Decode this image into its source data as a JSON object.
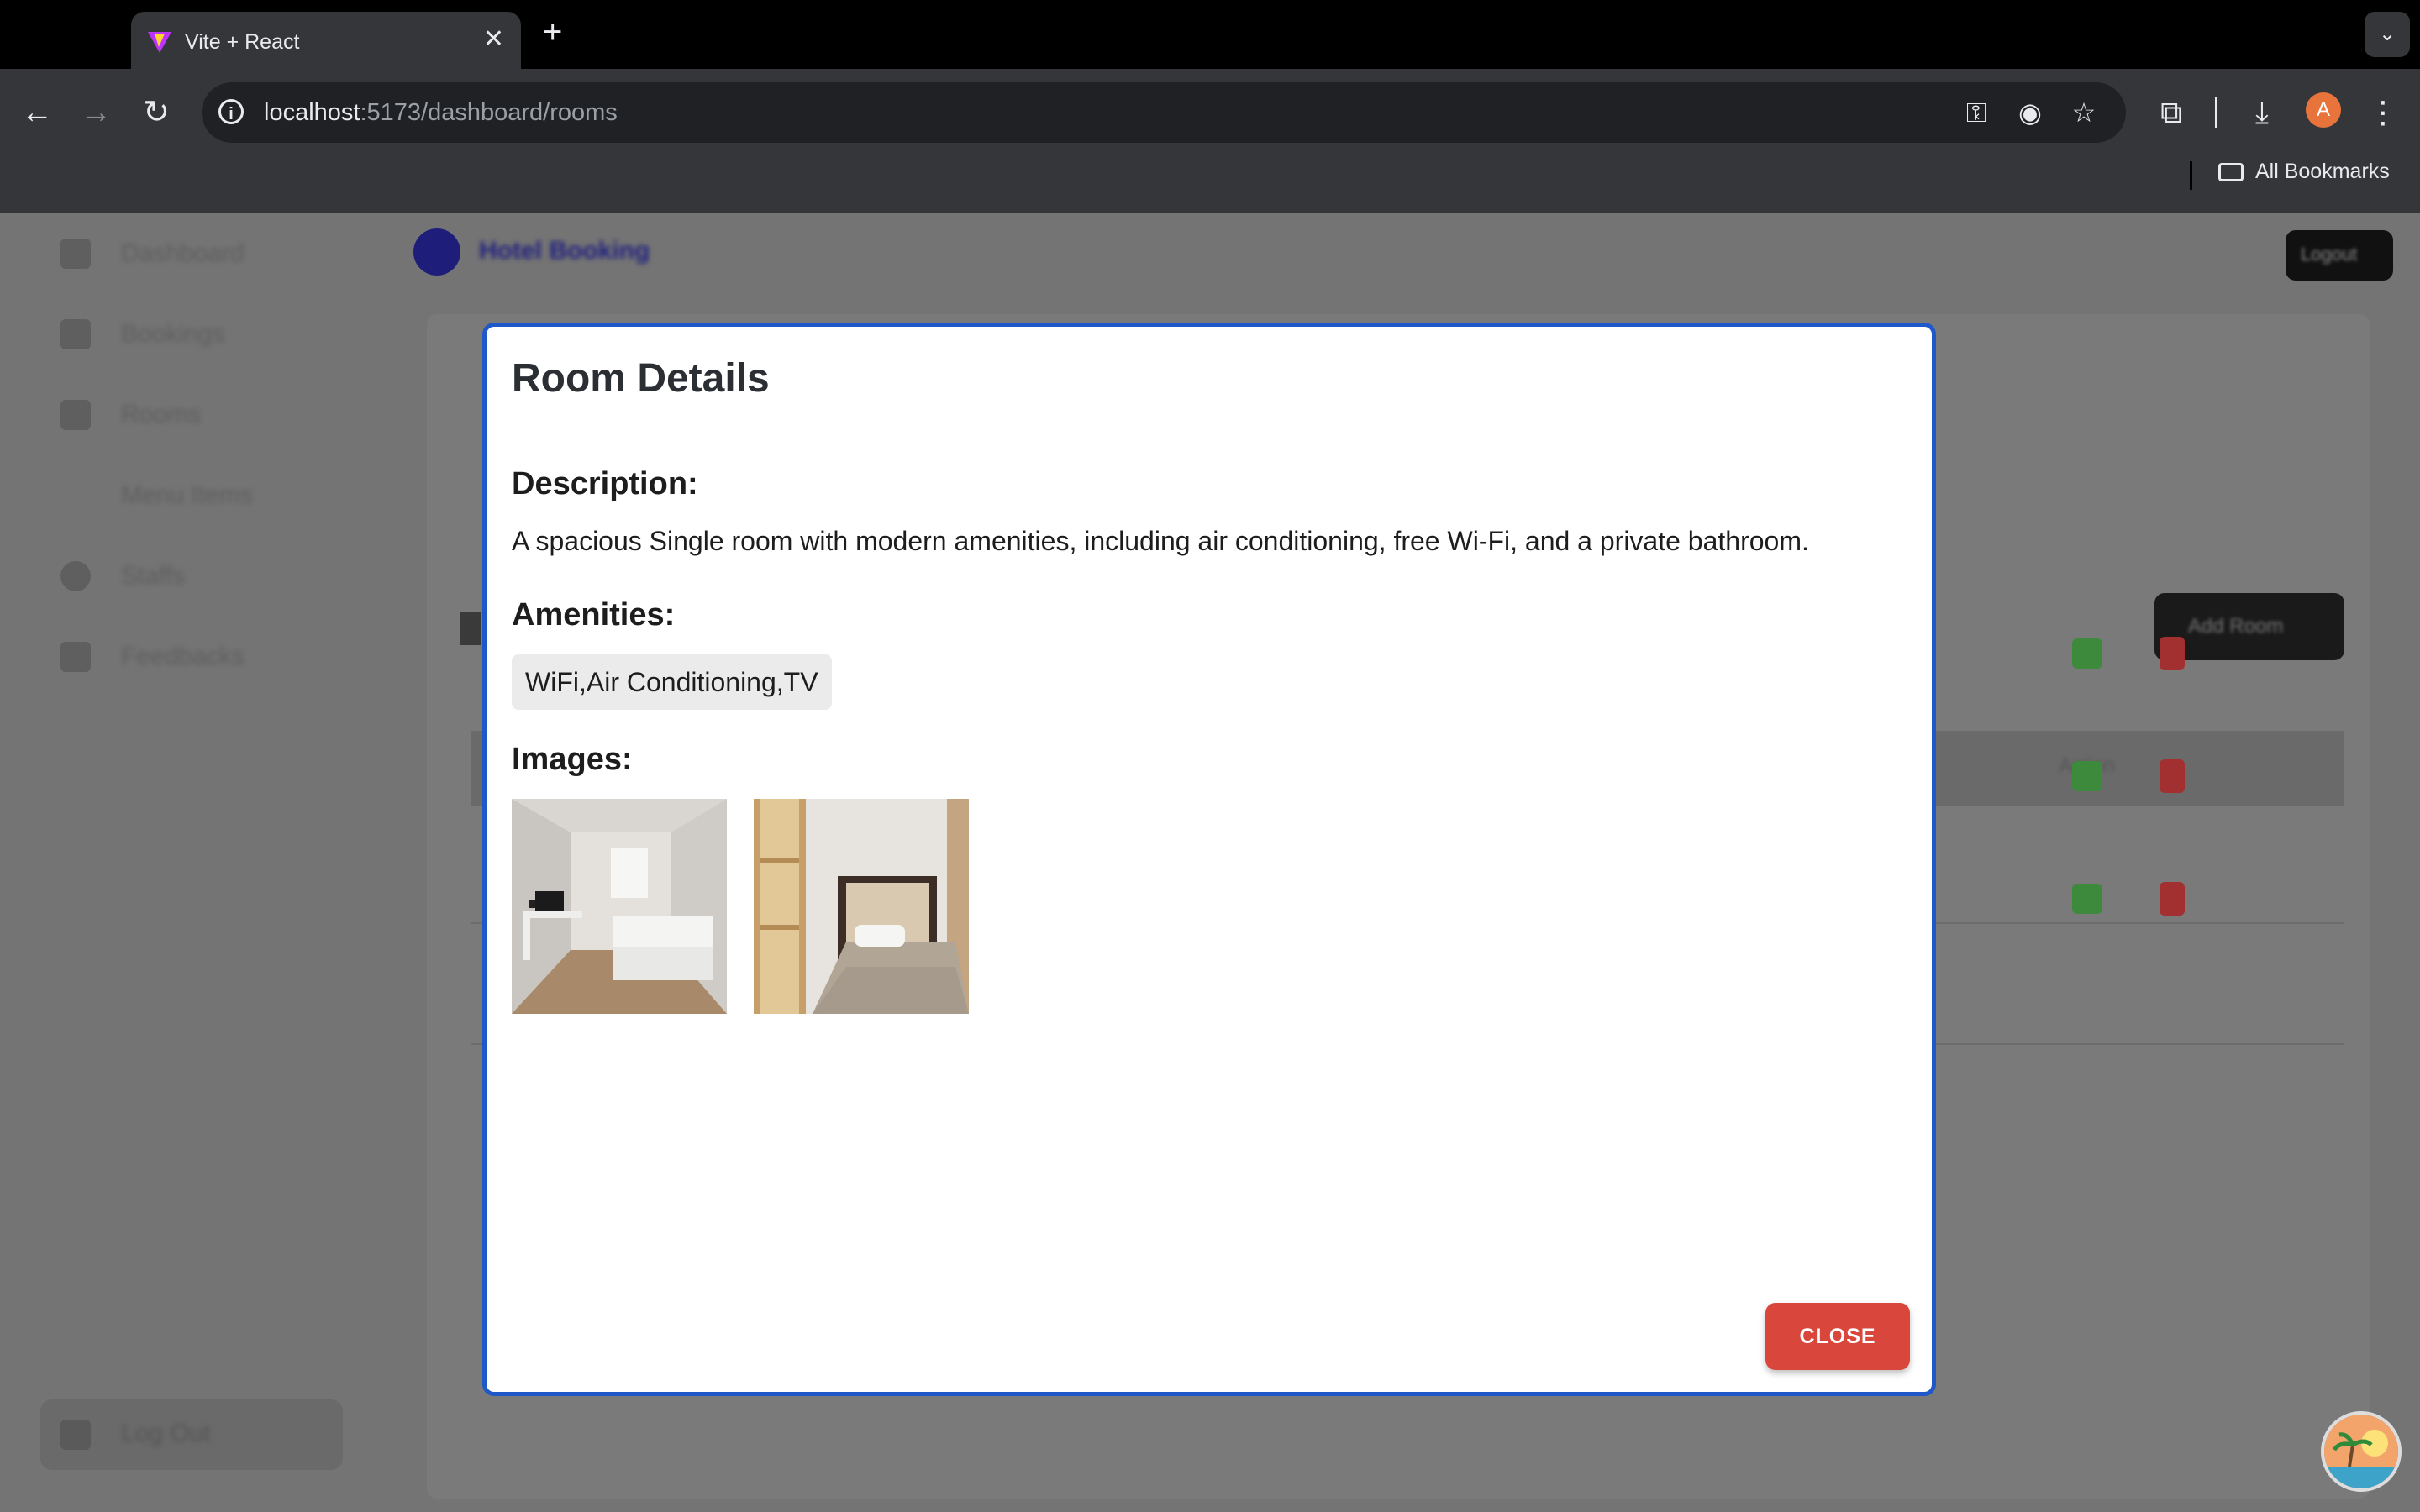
{
  "browser": {
    "tab_title": "Vite + React",
    "url_host": "localhost",
    "url_path": ":5173/dashboard/rooms",
    "profile_initial": "A",
    "bookmarks_label": "All Bookmarks"
  },
  "background": {
    "sidebar_items": [
      "Dashboard",
      "Bookings",
      "Rooms",
      "Menu Items",
      "Staffs",
      "Feedbacks"
    ],
    "logout_label": "Log Out",
    "header_title": "Hotel Booking",
    "header_button": "Logout",
    "add_room_label": "Add Room",
    "action_header": "Action"
  },
  "modal": {
    "title": "Room Details",
    "description_heading": "Description:",
    "description_text": "A spacious Single room with modern amenities, including air conditioning, free Wi-Fi, and a private bathroom.",
    "amenities_heading": "Amenities:",
    "amenities_value": "WiFi,Air Conditioning,TV",
    "images_heading": "Images:",
    "images": [
      "room-photo-1",
      "room-photo-2"
    ],
    "close_label": "CLOSE"
  },
  "colors": {
    "modal_border": "#1f58c8",
    "close_button": "#d9463b",
    "chip_bg": "#ebebeb"
  }
}
